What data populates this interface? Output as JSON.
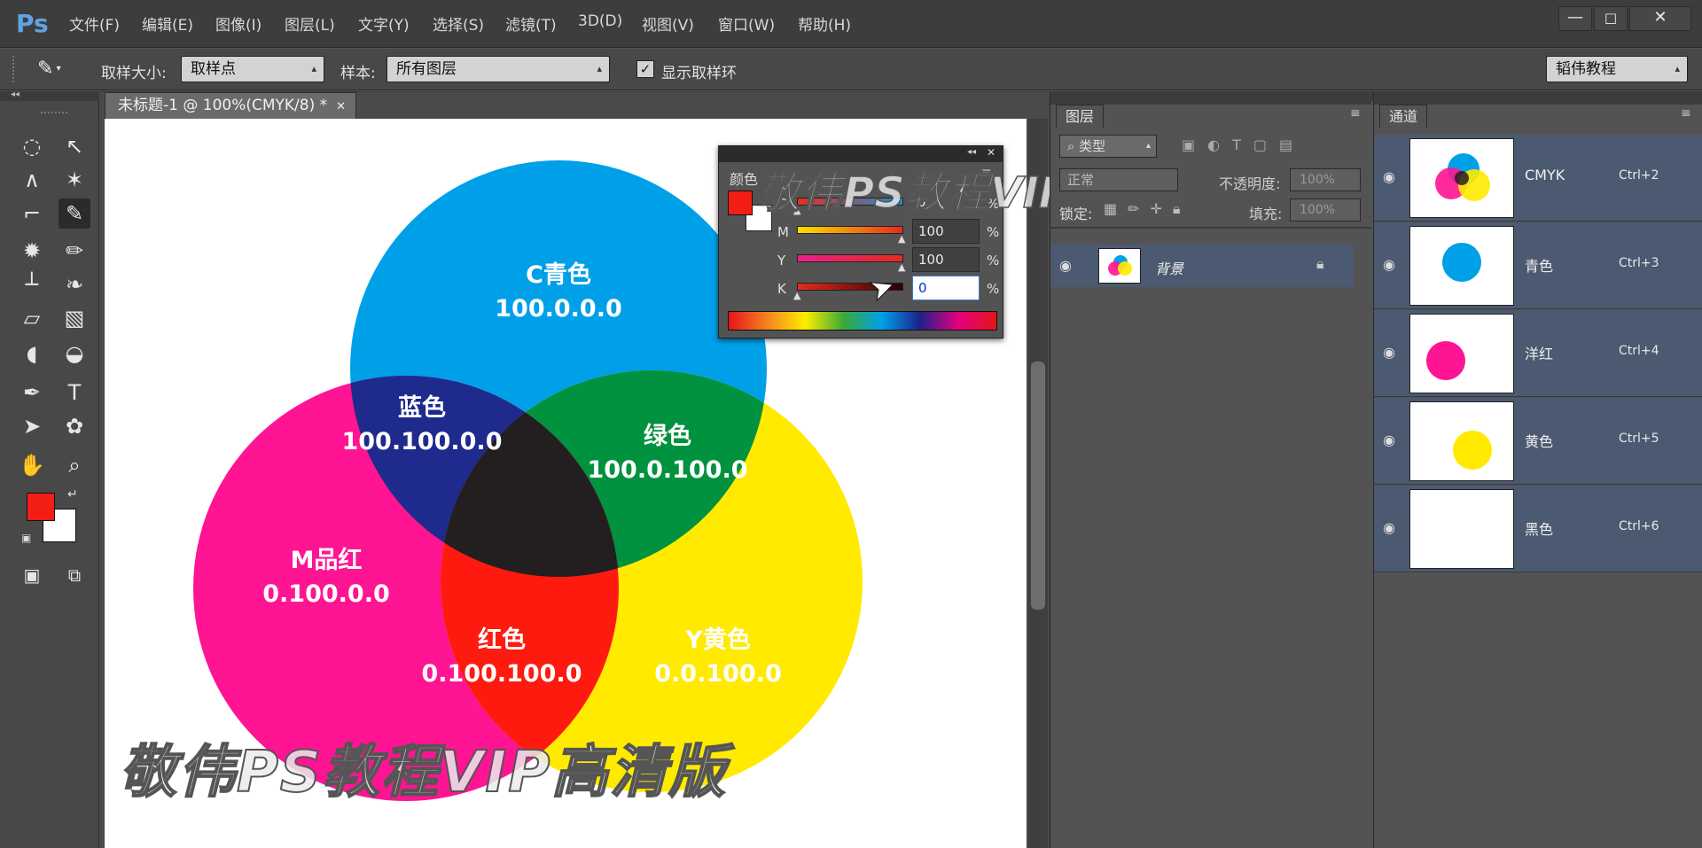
{
  "app": {
    "logo": "Ps"
  },
  "menu": [
    "文件(F)",
    "编辑(E)",
    "图像(I)",
    "图层(L)",
    "文字(Y)",
    "选择(S)",
    "滤镜(T)",
    "3D(D)",
    "视图(V)",
    "窗口(W)",
    "帮助(H)"
  ],
  "options": {
    "sample_size_label": "取样大小:",
    "sample_size_value": "取样点",
    "sample_label": "样本:",
    "sample_value": "所有图层",
    "show_ring_label": "显示取样环",
    "workspace_value": "韬伟教程"
  },
  "document": {
    "tab_title": "未标题-1 @ 100%(CMYK/8) *"
  },
  "venn": {
    "cyan": {
      "name": "C青色",
      "value": "100.0.0.0"
    },
    "magenta": {
      "name": "M品红",
      "value": "0.100.0.0"
    },
    "yellow": {
      "name": "Y黄色",
      "value": "0.0.100.0"
    },
    "blue": {
      "name": "蓝色",
      "value": "100.100.0.0"
    },
    "green": {
      "name": "绿色",
      "value": "100.0.100.0"
    },
    "red": {
      "name": "红色",
      "value": "0.100.100.0"
    }
  },
  "color_panel": {
    "title": "颜色",
    "sliders": [
      {
        "label": "C",
        "value": "0",
        "unit": "%",
        "fraction": 0.0
      },
      {
        "label": "M",
        "value": "100",
        "unit": "%",
        "fraction": 1.0
      },
      {
        "label": "Y",
        "value": "100",
        "unit": "%",
        "fraction": 1.0
      },
      {
        "label": "K",
        "value": "0",
        "unit": "%",
        "fraction": 0.0
      }
    ],
    "foreground_color": "#f21e16",
    "background_color": "#ffffff"
  },
  "watermark": "敬伟PS教程VIP高清版",
  "layers_panel": {
    "tab": "图层",
    "filter_label": "类型",
    "blend_mode": "正常",
    "opacity_label": "不透明度:",
    "opacity_value": "100%",
    "lock_label": "锁定:",
    "fill_label": "填充:",
    "fill_value": "100%",
    "layers": [
      {
        "name": "背景"
      }
    ]
  },
  "channels_panel": {
    "tab": "通道",
    "channels": [
      {
        "name": "CMYK",
        "shortcut": "Ctrl+2"
      },
      {
        "name": "青色",
        "shortcut": "Ctrl+3"
      },
      {
        "name": "洋红",
        "shortcut": "Ctrl+4"
      },
      {
        "name": "黄色",
        "shortcut": "Ctrl+5"
      },
      {
        "name": "黑色",
        "shortcut": "Ctrl+6"
      }
    ]
  },
  "colors": {
    "cyan": "#00a0e9",
    "magenta": "#ff1493",
    "yellow": "#ffea00",
    "blue": "#1e2a8c",
    "green": "#00923f",
    "red": "#ff1a10",
    "black": "#231f20"
  }
}
